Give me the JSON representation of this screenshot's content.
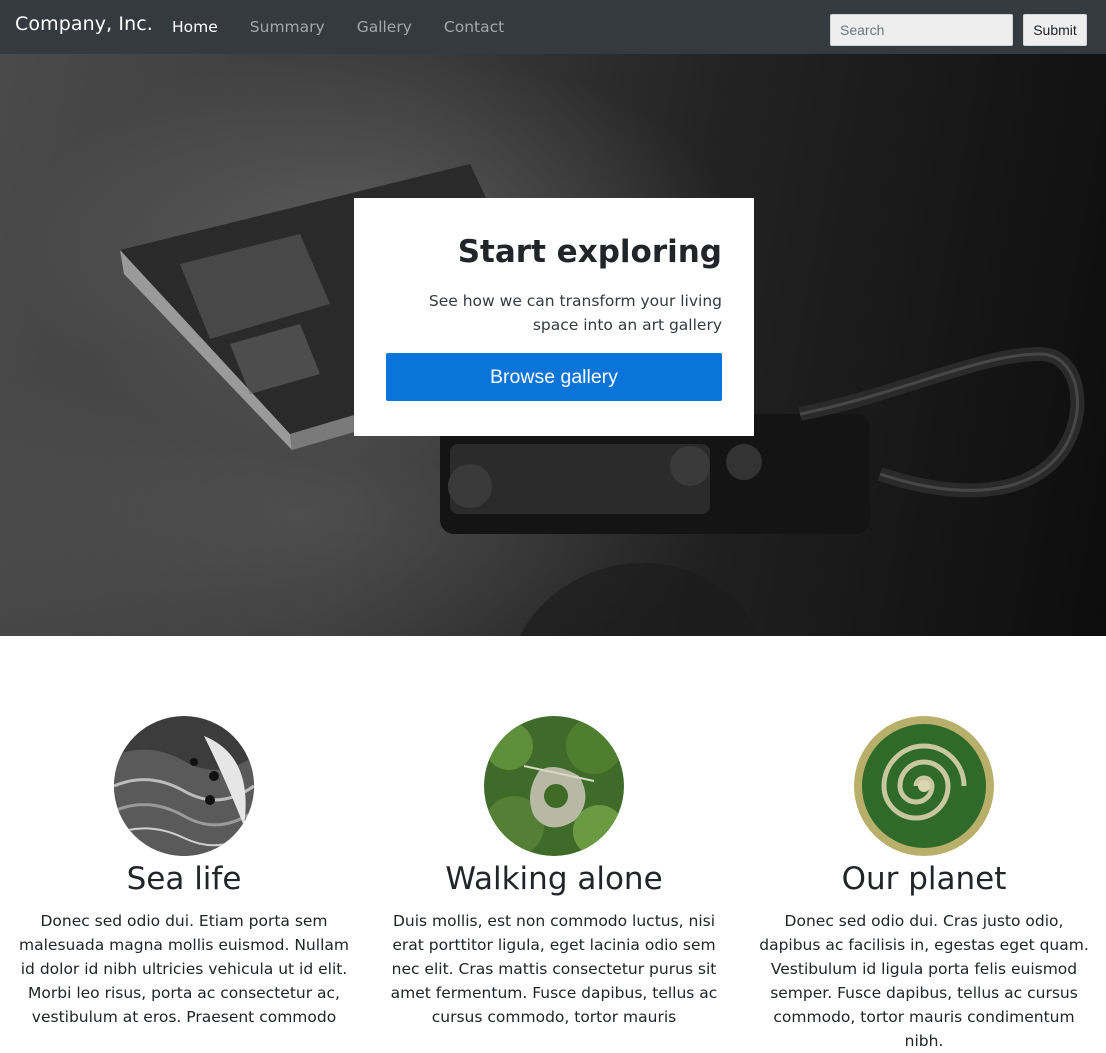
{
  "navbar": {
    "brand": "Company, Inc.",
    "links": [
      {
        "label": "Home",
        "active": true
      },
      {
        "label": "Summary",
        "active": false
      },
      {
        "label": "Gallery",
        "active": false
      },
      {
        "label": "Contact",
        "active": false
      }
    ],
    "search_placeholder": "Search",
    "submit_label": "Submit"
  },
  "hero": {
    "title": "Start exploring",
    "text": "See how we can transform your living space into an art gallery",
    "button_label": "Browse gallery"
  },
  "features": [
    {
      "title": "Sea life",
      "text": "Donec sed odio dui. Etiam porta sem malesuada magna mollis euismod. Nullam id dolor id nibh ultricies vehicula ut id elit. Morbi leo risus, porta ac consectetur ac, vestibulum at eros. Praesent commodo"
    },
    {
      "title": "Walking alone",
      "text": "Duis mollis, est non commodo luctus, nisi erat porttitor ligula, eget lacinia odio sem nec elit. Cras mattis consectetur purus sit amet fermentum. Fusce dapibus, tellus ac cursus commodo, tortor mauris"
    },
    {
      "title": "Our planet",
      "text": "Donec sed odio dui. Cras justo odio, dapibus ac facilisis in, egestas eget quam. Vestibulum id ligula porta felis euismod semper. Fusce dapibus, tellus ac cursus commodo, tortor mauris condimentum nibh."
    }
  ],
  "colors": {
    "navbar_bg": "#343a40",
    "primary_button": "#0a74da"
  }
}
